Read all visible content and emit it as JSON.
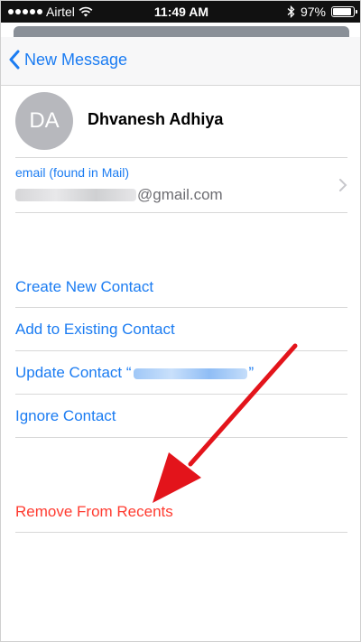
{
  "status_bar": {
    "carrier": "Airtel",
    "time": "11:49 AM",
    "battery": "97%",
    "battery_level": 0.97
  },
  "nav": {
    "back_label": "New Message"
  },
  "contact": {
    "initials": "DA",
    "name": "Dhvanesh Adhiya"
  },
  "email": {
    "label": "email (found in Mail)",
    "domain": "@gmail.com"
  },
  "actions": {
    "create": "Create New Contact",
    "add_existing": "Add to Existing Contact",
    "update_prefix": "Update Contact “",
    "update_suffix": "”",
    "ignore": "Ignore Contact",
    "remove": "Remove From Recents"
  },
  "colors": {
    "accent": "#1b7cf2",
    "destructive": "#ff3b30",
    "annotation_arrow": "#e3141b"
  },
  "icons": [
    "signal-dots-icon",
    "wifi-icon",
    "bluetooth-icon",
    "battery-icon",
    "chevron-left-icon",
    "chevron-right-icon",
    "annotation-arrow-icon"
  ]
}
